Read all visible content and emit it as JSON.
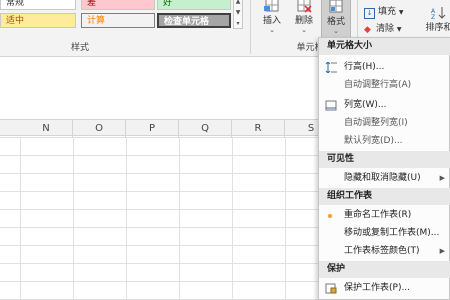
{
  "cell_styles": {
    "normal": "常规",
    "bad": "差",
    "good": "好",
    "neutral": "适中",
    "calculation": "计算",
    "check_cell": "检查单元格"
  },
  "groups": {
    "styles": "样式",
    "cells": "单元格"
  },
  "cells_group": {
    "insert": "插入",
    "delete": "删除",
    "format": "格式"
  },
  "editing_group": {
    "fill": "填充",
    "clear": "清除",
    "sort": "排序和"
  },
  "columns": [
    "N",
    "O",
    "P",
    "Q",
    "R",
    "S"
  ],
  "menu": {
    "cell_size_header": "单元格大小",
    "row_height": "行高(H)...",
    "autofit_row": "自动调整行高(A)",
    "column_width": "列宽(W)...",
    "autofit_column": "自动调整列宽(I)",
    "default_width": "默认列宽(D)...",
    "visibility_header": "可见性",
    "hide_unhide": "隐藏和取消隐藏(U)",
    "organize_header": "组织工作表",
    "rename_sheet": "重命名工作表(R)",
    "move_copy_sheet": "移动或复制工作表(M)...",
    "tab_color": "工作表标签颜色(T)",
    "protection_header": "保护",
    "protect_sheet": "保护工作表(P)..."
  },
  "colors": {
    "bad_fill": "#ffc7ce",
    "good_fill": "#c6efce",
    "neutral_fill": "#ffeb9c",
    "check_fill": "#a5a5a5",
    "menu_header": "#e8e8e8",
    "bullet": "#f0a030"
  }
}
